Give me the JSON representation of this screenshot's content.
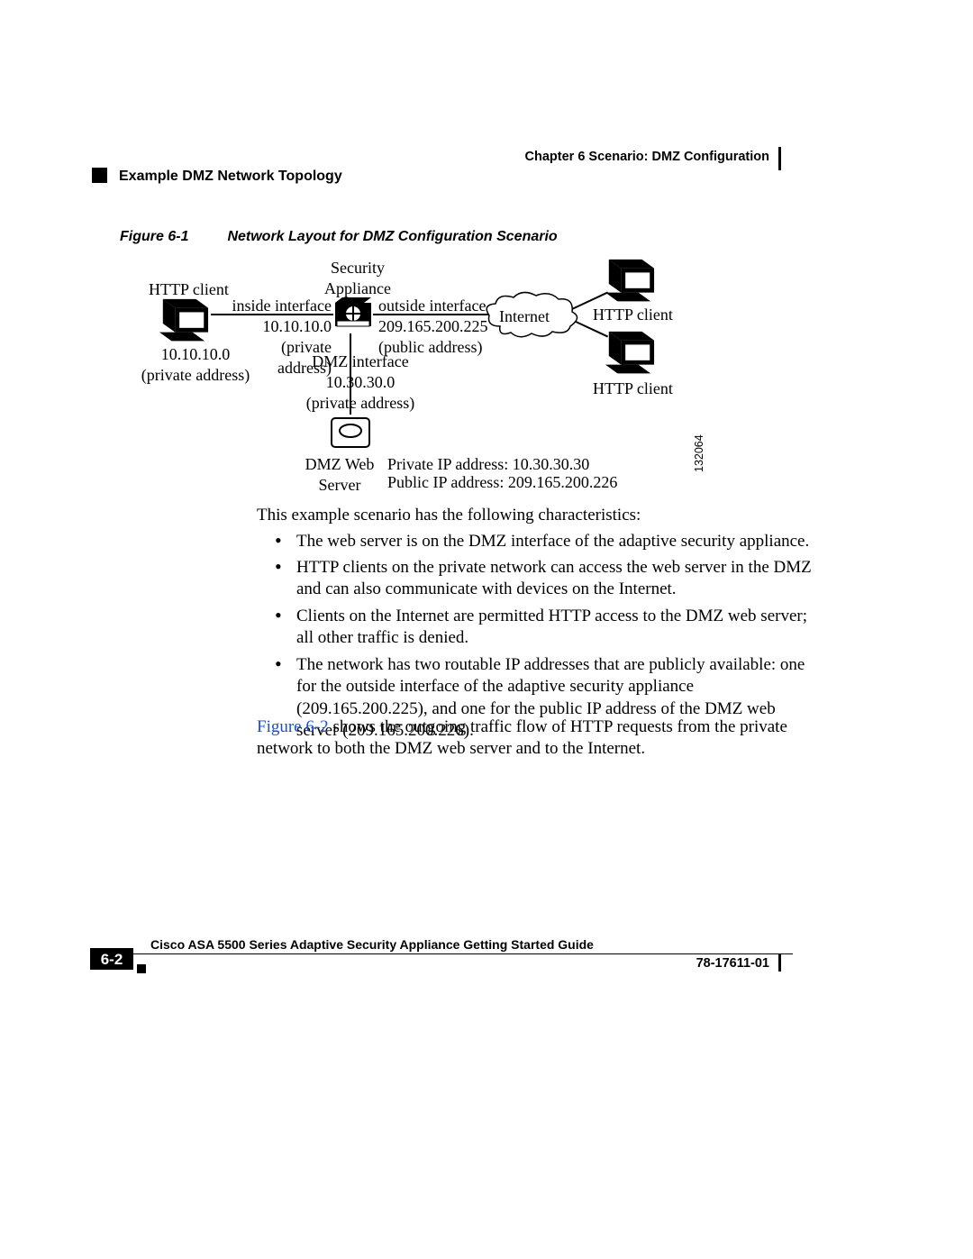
{
  "header": {
    "chapter": "Chapter 6      Scenario: DMZ Configuration",
    "section": "Example DMZ Network Topology"
  },
  "figure": {
    "num": "Figure 6-1",
    "caption": "Network Layout for DMZ Configuration Scenario",
    "image_id": "132064",
    "labels": {
      "sec_app_l1": "Security",
      "sec_app_l2": "Appliance",
      "client_left": "HTTP client",
      "inside1": "inside interface",
      "inside2": "10.10.10.0",
      "inside3": "(private address)",
      "outside1": "outside interface",
      "outside2": "209.165.200.225",
      "outside3": "(public address)",
      "internet": "Internet",
      "client_r1": "HTTP client",
      "client_r2": "HTTP client",
      "left_ip1": "10.10.10.0",
      "left_ip2": "(private address)",
      "dmz1": "DMZ interface",
      "dmz2": "10.30.30.0",
      "dmz3": "(private address)",
      "server1": "DMZ Web",
      "server2": "Server",
      "priv_ip": "Private IP address: 10.30.30.30",
      "pub_ip": "Public IP address:  209.165.200.226"
    }
  },
  "body": {
    "intro": "This example scenario has the following characteristics:",
    "b1": "The web server is on the DMZ interface of the adaptive security appliance.",
    "b2": "HTTP clients on the private network can access the web server in the DMZ and can also communicate with devices on the Internet.",
    "b3": "Clients on the Internet are permitted HTTP access to the DMZ web server; all other traffic is denied.",
    "b4": "The network has two routable IP addresses that are publicly available: one for the outside interface of the adaptive security appliance (209.165.200.225), and one for the public IP address of the DMZ web server (209.165.200.226).",
    "follow_link": "Figure 6-2",
    "follow_rest": " shows the outgoing traffic flow of HTTP requests from the private network to both the DMZ web server and to the Internet."
  },
  "footer": {
    "title": "Cisco ASA 5500 Series Adaptive Security Appliance Getting Started Guide",
    "page": "6-2",
    "docnum": "78-17611-01"
  }
}
